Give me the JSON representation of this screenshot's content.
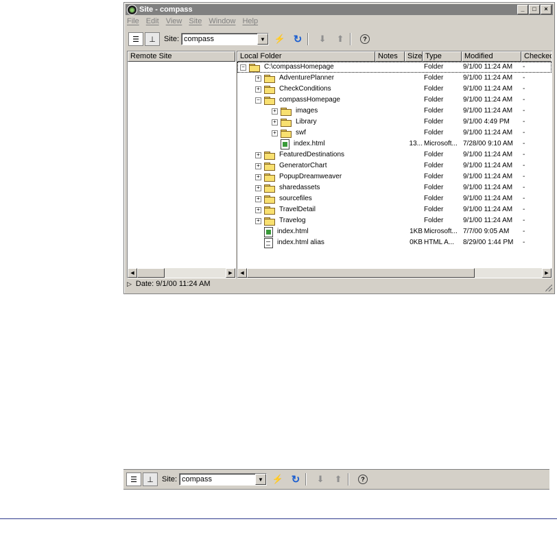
{
  "window": {
    "title": "Site - compass",
    "controls": [
      "_",
      "□",
      "×"
    ]
  },
  "menu": [
    "File",
    "Edit",
    "View",
    "Site",
    "Window",
    "Help"
  ],
  "toolbar": {
    "site_label": "Site:",
    "site_value": "compass"
  },
  "remote_pane": {
    "header": "Remote Site"
  },
  "local_pane": {
    "columns": [
      "Local Folder",
      "Notes",
      "Size",
      "Type",
      "Modified",
      "Checked"
    ],
    "rows": [
      {
        "name": "C:\\compassHomepage",
        "size": "",
        "type": "Folder",
        "modified": "9/1/00 11:24 AM",
        "checked": "-"
      },
      {
        "name": "AdventurePlanner",
        "size": "",
        "type": "Folder",
        "modified": "9/1/00 11:24 AM",
        "checked": "-"
      },
      {
        "name": "CheckConditions",
        "size": "",
        "type": "Folder",
        "modified": "9/1/00 11:24 AM",
        "checked": "-"
      },
      {
        "name": "compassHomepage",
        "size": "",
        "type": "Folder",
        "modified": "9/1/00 11:24 AM",
        "checked": "-"
      },
      {
        "name": "images",
        "size": "",
        "type": "Folder",
        "modified": "9/1/00 11:24 AM",
        "checked": "-"
      },
      {
        "name": "Library",
        "size": "",
        "type": "Folder",
        "modified": "9/1/00 4:49 PM",
        "checked": "-"
      },
      {
        "name": "swf",
        "size": "",
        "type": "Folder",
        "modified": "9/1/00 11:24 AM",
        "checked": "-"
      },
      {
        "name": "index.html",
        "size": "13...",
        "type": "Microsoft...",
        "modified": "7/28/00 9:10 AM",
        "checked": "-"
      },
      {
        "name": "FeaturedDestinations",
        "size": "",
        "type": "Folder",
        "modified": "9/1/00 11:24 AM",
        "checked": "-"
      },
      {
        "name": "GeneratorChart",
        "size": "",
        "type": "Folder",
        "modified": "9/1/00 11:24 AM",
        "checked": "-"
      },
      {
        "name": "PopupDreamweaver",
        "size": "",
        "type": "Folder",
        "modified": "9/1/00 11:24 AM",
        "checked": "-"
      },
      {
        "name": "sharedassets",
        "size": "",
        "type": "Folder",
        "modified": "9/1/00 11:24 AM",
        "checked": "-"
      },
      {
        "name": "sourcefiles",
        "size": "",
        "type": "Folder",
        "modified": "9/1/00 11:24 AM",
        "checked": "-"
      },
      {
        "name": "TravelDetail",
        "size": "",
        "type": "Folder",
        "modified": "9/1/00 11:24 AM",
        "checked": "-"
      },
      {
        "name": "Travelog",
        "size": "",
        "type": "Folder",
        "modified": "9/1/00 11:24 AM",
        "checked": "-"
      },
      {
        "name": "index.html",
        "size": "1KB",
        "type": "Microsoft...",
        "modified": "7/7/00 9:05 AM",
        "checked": "-"
      },
      {
        "name": "index.html alias",
        "size": "0KB",
        "type": "HTML A...",
        "modified": "8/29/00 1:44 PM",
        "checked": "-"
      }
    ]
  },
  "status": {
    "text": "Date: 9/1/00 11:24 AM"
  },
  "toolbar_standalone": {
    "site_label": "Site:",
    "site_value": "compass"
  }
}
